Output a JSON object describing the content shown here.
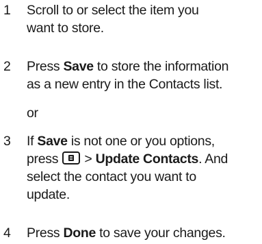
{
  "steps": [
    {
      "number": "1",
      "line1": "Scroll to or select the item you",
      "line2": "want to store."
    },
    {
      "number": "2",
      "line1_pre": "Press ",
      "line1_bold": "Save",
      "line1_post": " to store the information",
      "line2": "as a new entry in the Contacts list."
    },
    {
      "number": "3",
      "line1_pre": "If ",
      "line1_bold": "Save",
      "line1_post": " is not one or you options,",
      "line2_pre": "press ",
      "line2_key_icon": "menu-key-icon",
      "line2_sep": " > ",
      "line2_bold": "Update Contacts",
      "line2_post": ". And",
      "line3": "select the contact you want to",
      "line4": "update."
    },
    {
      "number": "4",
      "line1_pre": "Press ",
      "line1_bold": "Done",
      "line1_post": " to save your changes."
    }
  ],
  "or_text": "or"
}
